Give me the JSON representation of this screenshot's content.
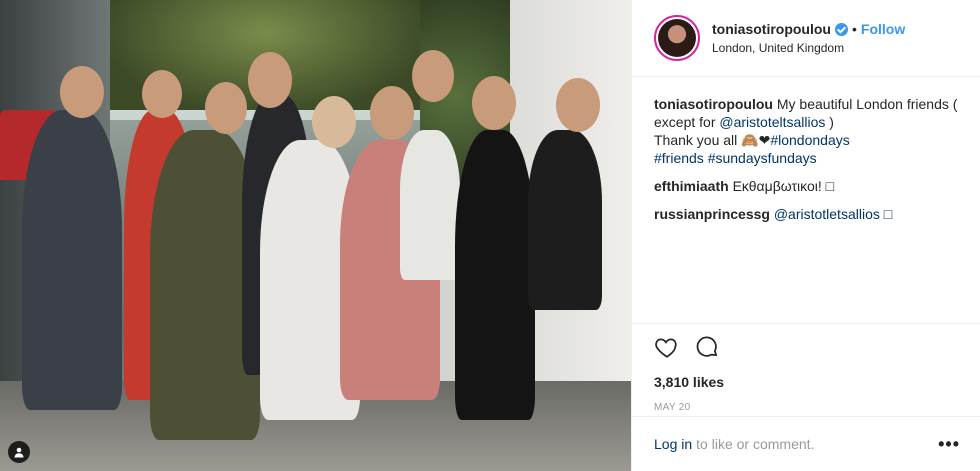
{
  "post": {
    "username": "toniasotiropoulou",
    "follow_label": "Follow",
    "separator": "•",
    "location": "London, United Kingdom",
    "caption": {
      "username": "toniasotiropoulou",
      "text_1": "My beautiful London friends ( except for",
      "mention": "@aristoteltsallios",
      "text_2": ")",
      "text_3": "Thank you all 🙈❤",
      "hashtags_1": "#londondays",
      "hashtags_2": "#friends #sundaysfundays"
    },
    "comments": [
      {
        "username": "efthimiaath",
        "text": "Εκθαμβωτικοι! □"
      },
      {
        "username": "russianprincessg",
        "text": "@aristotletsallios □"
      }
    ],
    "likes": "3,810 likes",
    "date": "MAY 20",
    "login_link": "Log in",
    "login_rest": "to like or comment.",
    "more_label": "•••"
  },
  "icons": {
    "heart": "heart-icon",
    "comment": "comment-icon",
    "user_tag": "user-tag-icon",
    "verified": "verified-icon"
  }
}
